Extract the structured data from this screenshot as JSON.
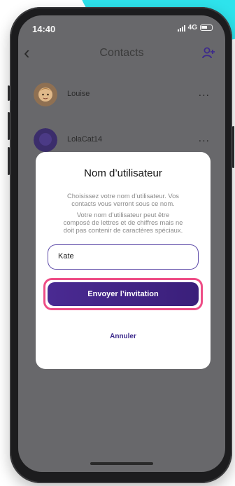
{
  "status_bar": {
    "time": "14:40",
    "network": "4G"
  },
  "nav": {
    "back_icon": "chevron-left-icon",
    "title": "Contacts",
    "add_icon": "add-contact-icon"
  },
  "contacts": [
    {
      "name": "Louise",
      "more": "..."
    },
    {
      "name": "LolaCat14",
      "more": "..."
    }
  ],
  "modal": {
    "title": "Nom d’utilisateur",
    "paragraph1_line1": "Choisissez votre nom d’utilisateur. Vos",
    "paragraph1_line2": "contacts vous verront sous ce nom.",
    "paragraph2_line1": "Votre nom d’utilisateur peut être",
    "paragraph2_line2": "composé de lettres et de chiffres mais ne",
    "paragraph2_line3": "doit pas contenir de caractères spéciaux.",
    "input_value": "Kate",
    "send_label": "Envoyer l’invitation",
    "cancel_label": "Annuler"
  },
  "colors": {
    "accent": "#3d2a8c",
    "highlight": "#ee4d86",
    "decor": "#2ee3ec"
  }
}
